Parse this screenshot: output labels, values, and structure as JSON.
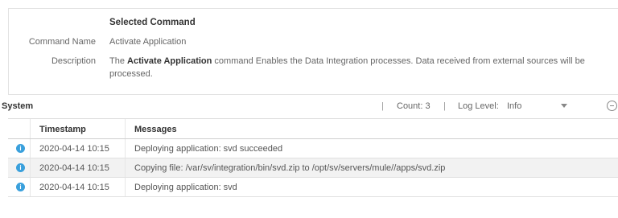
{
  "command": {
    "section_title": "Selected Command",
    "name_label": "Command Name",
    "name_value": "Activate Application",
    "description_label": "Description",
    "description_prefix": "The ",
    "description_bold": "Activate Application",
    "description_suffix": " command Enables the Data Integration processes. Data received from external sources will be processed."
  },
  "system": {
    "title": "System",
    "separator": "|",
    "count_text": "Count: 3",
    "log_level_label": "Log Level:",
    "log_level_value": "Info",
    "dropdown_icon": "chevron-down-icon",
    "collapse_icon": "minus-circle-icon"
  },
  "table": {
    "headers": {
      "timestamp": "Timestamp",
      "messages": "Messages"
    },
    "rows": [
      {
        "icon": "info-icon",
        "icon_glyph": "i",
        "timestamp": "2020-04-14 10:15",
        "message": "Deploying application: svd succeeded"
      },
      {
        "icon": "info-icon",
        "icon_glyph": "i",
        "timestamp": "2020-04-14 10:15",
        "message": "Copying file: /var/sv/integration/bin/svd.zip to /opt/sv/servers/mule//apps/svd.zip"
      },
      {
        "icon": "info-icon",
        "icon_glyph": "i",
        "timestamp": "2020-04-14 10:15",
        "message": "Deploying application: svd"
      }
    ]
  },
  "colors": {
    "info_icon": "#3aa0dc",
    "alt_row": "#f2f2f2",
    "border": "#e2e2e2"
  }
}
